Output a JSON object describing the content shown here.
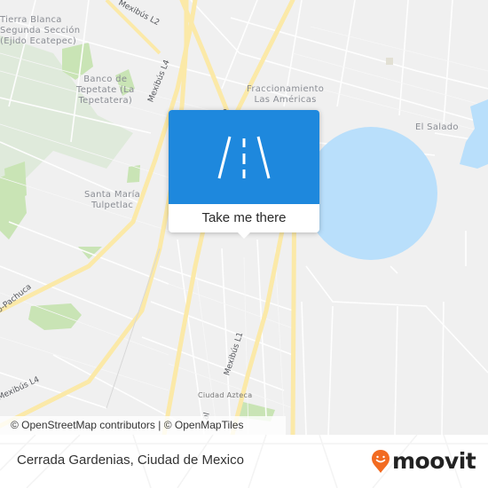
{
  "map": {
    "colors": {
      "land": "#f0f0f0",
      "road_major": "#fbe9a8",
      "road_minor": "#ffffff",
      "park": "#c9e4b5",
      "forest": "#dbe8d3",
      "water": "#b9dffb"
    },
    "places": [
      {
        "name": "Tierra Blanca Segunda Sección (Ejido Ecatepec)",
        "lines": [
          "Tierra Blanca",
          "Segunda Sección",
          "(Ejido Ecatepec)"
        ]
      },
      {
        "name": "Banco de Tepetate (La Tepetatera)",
        "lines": [
          "Banco de",
          "Tepetate (La",
          "Tepetatera)"
        ]
      },
      {
        "name": "Fraccionamiento Las Américas",
        "lines": [
          "Fraccionamiento",
          "Las Américas"
        ]
      },
      {
        "name": "El Salado",
        "lines": [
          "El Salado"
        ]
      },
      {
        "name": "Santa María Tulpetlac",
        "lines": [
          "Santa María",
          "Tulpetlac"
        ]
      },
      {
        "name": "Ciudad Azteca",
        "lines": [
          "Ciudad Azteca"
        ]
      }
    ],
    "roads": [
      {
        "label": "Mexibús L2"
      },
      {
        "label": "Mexibús L4"
      },
      {
        "label": "Mexibús L4"
      },
      {
        "label": "Mexibús L1"
      },
      {
        "label": "o-Pachuca"
      },
      {
        "label": "al"
      },
      {
        "label": "e"
      }
    ]
  },
  "popup": {
    "icon": "road-icon",
    "cta_label": "Take me there",
    "color": "#1e88dd"
  },
  "attribution": "© OpenStreetMap contributors | © OpenMapTiles",
  "footer": {
    "place_name": "Cerrada Gardenias, Ciudad de Mexico",
    "brand": "moovit",
    "brand_color": "#f26b21"
  }
}
